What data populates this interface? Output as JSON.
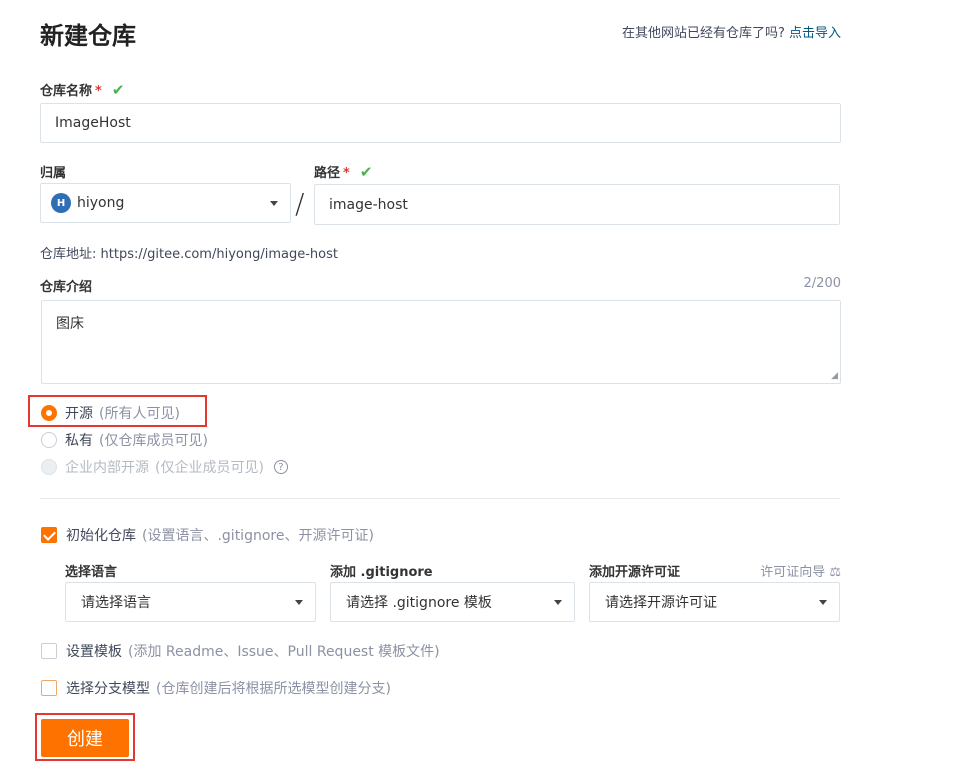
{
  "header": {
    "title": "新建仓库",
    "import_hint": "在其他网站已经有仓库了吗?",
    "import_link": "点击导入"
  },
  "repo_name": {
    "label": "仓库名称",
    "required_mark": "*",
    "value": "ImageHost"
  },
  "owner": {
    "label": "归属",
    "avatar_letter": "H",
    "value": "hiyong"
  },
  "separator": "/",
  "path": {
    "label": "路径",
    "required_mark": "*",
    "value": "image-host"
  },
  "repo_address": "仓库地址: https://gitee.com/hiyong/image-host",
  "description": {
    "label": "仓库介绍",
    "counter": "2/200",
    "value": "图床"
  },
  "visibility": {
    "options": [
      {
        "label": "开源",
        "hint": "(所有人可见)",
        "selected": true,
        "disabled": false
      },
      {
        "label": "私有",
        "hint": "(仅仓库成员可见)",
        "selected": false,
        "disabled": false
      },
      {
        "label": "企业内部开源",
        "hint": "(仅企业成员可见)",
        "selected": false,
        "disabled": true
      }
    ],
    "help_icon": "?"
  },
  "init_repo": {
    "label": "初始化仓库",
    "hint": "(设置语言、.gitignore、开源许可证)",
    "checked": true,
    "language": {
      "label": "选择语言",
      "placeholder": "请选择语言"
    },
    "gitignore": {
      "label": "添加 .gitignore",
      "placeholder": "请选择 .gitignore 模板"
    },
    "license": {
      "label": "添加开源许可证",
      "wizard_link": "许可证向导",
      "wizard_icon": "⚖",
      "placeholder": "请选择开源许可证"
    }
  },
  "template": {
    "label": "设置模板",
    "hint": "(添加 Readme、Issue、Pull Request 模板文件)",
    "checked": false
  },
  "branch_model": {
    "label": "选择分支模型",
    "hint": "(仓库创建后将根据所选模型创建分支)",
    "checked": false
  },
  "submit": {
    "label": "创建"
  },
  "colors": {
    "accent": "#fe7300",
    "highlight_box": "#e3372f",
    "check": "#4caf50",
    "link": "#005980"
  }
}
